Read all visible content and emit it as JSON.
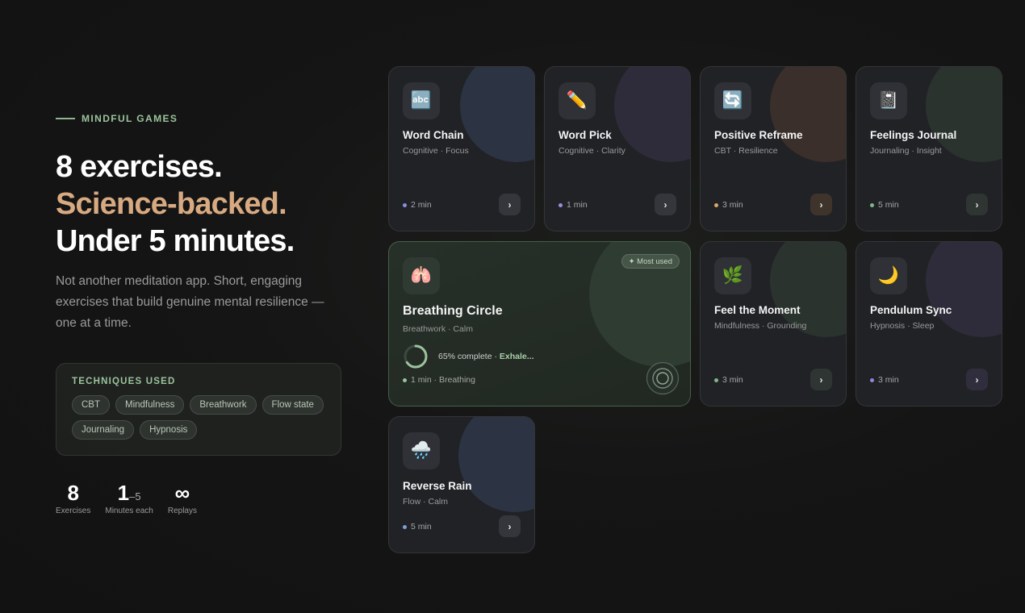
{
  "hero": {
    "eyebrow": "MINDFUL GAMES",
    "line1": "8 exercises.",
    "line2": "Science-backed.",
    "line3": "Under 5 minutes.",
    "description": "Not another meditation app. Short, engaging exercises that build genuine mental resilience — one at a time."
  },
  "techniques": {
    "title": "TECHNIQUES USED",
    "chips": [
      "CBT",
      "Mindfulness",
      "Breathwork",
      "Flow state",
      "Journaling",
      "Hypnosis"
    ]
  },
  "stats": [
    {
      "value": "8",
      "suffix": "",
      "label": "Exercises"
    },
    {
      "value": "1",
      "suffix": "–5",
      "label": "Minutes each"
    },
    {
      "value": "∞",
      "suffix": "",
      "label": "Replays"
    }
  ],
  "cards": [
    {
      "name": "Word Chain",
      "sub": "Cognitive · Focus",
      "meta": "2 min",
      "icon": "abc-icon",
      "emoji": "🔤",
      "accent": "#8a8ee0",
      "blob": "#2c3342"
    },
    {
      "name": "Word Pick",
      "sub": "Cognitive · Clarity",
      "meta": "1 min",
      "icon": "pencil-icon",
      "emoji": "✏️",
      "accent": "#9d8ee0",
      "blob": "#2e2c3a"
    },
    {
      "name": "Positive Reframe",
      "sub": "CBT · Resilience",
      "meta": "3 min",
      "icon": "refresh-icon",
      "emoji": "🔄",
      "accent": "#d9a86a",
      "blob": "#3a2f2a"
    },
    {
      "name": "Feelings Journal",
      "sub": "Journaling · Insight",
      "meta": "5 min",
      "icon": "notebook-icon",
      "emoji": "📓",
      "accent": "#7fb88a",
      "blob": "#2a332e"
    },
    {
      "name": "Breathing Circle",
      "sub": "Breathwork · Calm",
      "meta": "1 min · Breathing",
      "icon": "lungs-icon",
      "emoji": "🫁",
      "accent": "#9cc39d",
      "blob": "#2e3c32",
      "badge": "✦ Most used",
      "progress_pct": 65,
      "progress_text": "65% complete · ",
      "progress_phase": "Exhale..."
    },
    {
      "name": "Feel the Moment",
      "sub": "Mindfulness · Grounding",
      "meta": "3 min",
      "icon": "herb-icon",
      "emoji": "🌿",
      "accent": "#7fb88a",
      "blob": "#2a332e"
    },
    {
      "name": "Pendulum Sync",
      "sub": "Hypnosis · Sleep",
      "meta": "3 min",
      "icon": "moon-icon",
      "emoji": "🌙",
      "accent": "#8f86d6",
      "blob": "#2e2c3a"
    },
    {
      "name": "Reverse Rain",
      "sub": "Flow · Calm",
      "meta": "5 min",
      "icon": "rain-cloud-icon",
      "emoji": "🌧️",
      "accent": "#7f9ed6",
      "blob": "#2c3342"
    }
  ]
}
